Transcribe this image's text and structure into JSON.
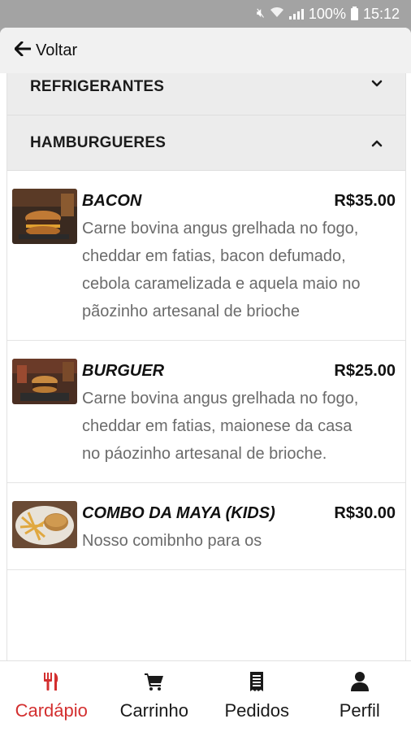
{
  "status_bar": {
    "battery": "100%",
    "time": "15:12"
  },
  "topbar": {
    "back_label": "Voltar"
  },
  "categories": [
    {
      "name": "REFRIGERANTES",
      "expanded": false
    },
    {
      "name": "HAMBURGUERES",
      "expanded": true
    }
  ],
  "items": [
    {
      "name": "BACON",
      "price": "R$35.00",
      "description": "Carne bovina angus grelhada no fogo, cheddar em fatias, bacon defumado, cebola caramelizada e aquela maio no pãozinho artesanal de brioche"
    },
    {
      "name": "BURGUER",
      "price": "R$25.00",
      "description": "Carne bovina angus grelhada no fogo, cheddar em fatias, maionese da casa no páozinho artesanal de brioche."
    },
    {
      "name": "COMBO DA MAYA (KIDS)",
      "price": "R$30.00",
      "description": "Nosso comibnho para os"
    }
  ],
  "bottom_nav": [
    {
      "label": "Cardápio",
      "icon": "utensils-icon",
      "active": true
    },
    {
      "label": "Carrinho",
      "icon": "cart-icon",
      "active": false
    },
    {
      "label": "Pedidos",
      "icon": "receipt-icon",
      "active": false
    },
    {
      "label": "Perfil",
      "icon": "user-icon",
      "active": false
    }
  ],
  "colors": {
    "accent": "#d32f2f",
    "header_bg": "#ececec",
    "status_bar_bg": "#a3a3a3"
  }
}
